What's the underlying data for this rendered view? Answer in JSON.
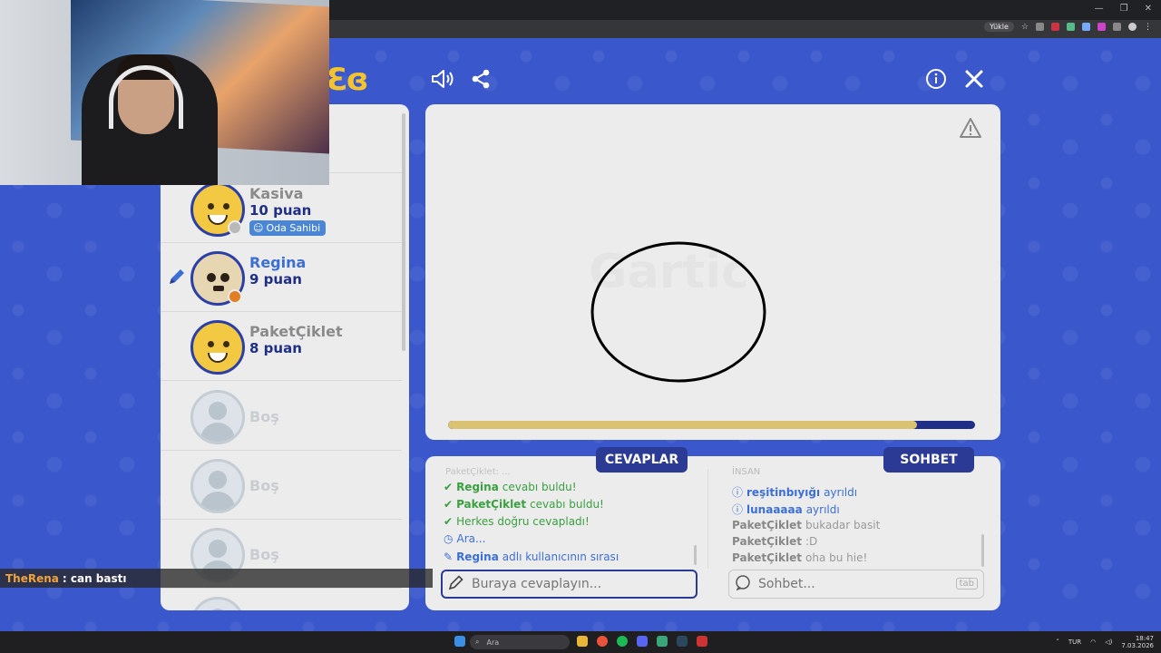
{
  "browser": {
    "translate_label": "Yükle",
    "win_controls": [
      "—",
      "❐",
      "✕"
    ]
  },
  "game": {
    "logo_text": "Ɛɞ",
    "players": [
      {
        "name": "Kasiva",
        "score": "10 puan",
        "badge": "Oda Sahibi",
        "status_color": "#b9b9b9",
        "avatar": "smiley"
      },
      {
        "name": "Regina",
        "score": "9 puan",
        "status_color": "#e37f22",
        "avatar": "skull",
        "drawing": true
      },
      {
        "name": "PaketÇiklet",
        "score": "8 puan",
        "avatar": "smiley"
      },
      {
        "name": "Boş",
        "avatar": "empty"
      },
      {
        "name": "Boş",
        "avatar": "empty"
      },
      {
        "name": "Boş",
        "avatar": "empty"
      }
    ],
    "canvas": {
      "watermark": "Gartic",
      "progress": 0.89
    },
    "answers": {
      "tab_label": "CEVAPLAR",
      "partial_top": "PaketÇiklet: ...",
      "messages": [
        {
          "user": "Regina",
          "text": "cevabı buldu!",
          "type": "correct"
        },
        {
          "user": "PaketÇiklet",
          "text": "cevabı buldu!",
          "type": "correct"
        },
        {
          "user": "",
          "text": "Herkes doğru cevapladı!",
          "type": "correct"
        },
        {
          "user": "",
          "text": "Ara...",
          "type": "info"
        },
        {
          "user": "Regina",
          "text": "adlı kullanıcının sırası",
          "type": "turn"
        }
      ],
      "input_placeholder": "Buraya cevaplayın..."
    },
    "chat": {
      "tab_label": "SOHBET",
      "partial_top": "İNSAN",
      "messages": [
        {
          "user": "reşitinbıyığı",
          "text": "ayrıldı",
          "type": "left"
        },
        {
          "user": "lunaaaaa",
          "text": "ayrıldı",
          "type": "left"
        },
        {
          "user": "PaketÇiklet",
          "text": "bukadar basit",
          "type": "chat"
        },
        {
          "user": "PaketÇiklet",
          "text": ":D",
          "type": "chat"
        },
        {
          "user": "PaketÇiklet",
          "text": "oha bu hie!",
          "type": "chat"
        }
      ],
      "input_placeholder": "Sohbet...",
      "tab_key": "tab"
    }
  },
  "stream_overlay": {
    "user": "TheRena",
    "message": ": can bastı"
  },
  "taskbar": {
    "search_placeholder": "Ara",
    "lang": "TUR",
    "time": "18:47",
    "date": "7.03.2026"
  }
}
